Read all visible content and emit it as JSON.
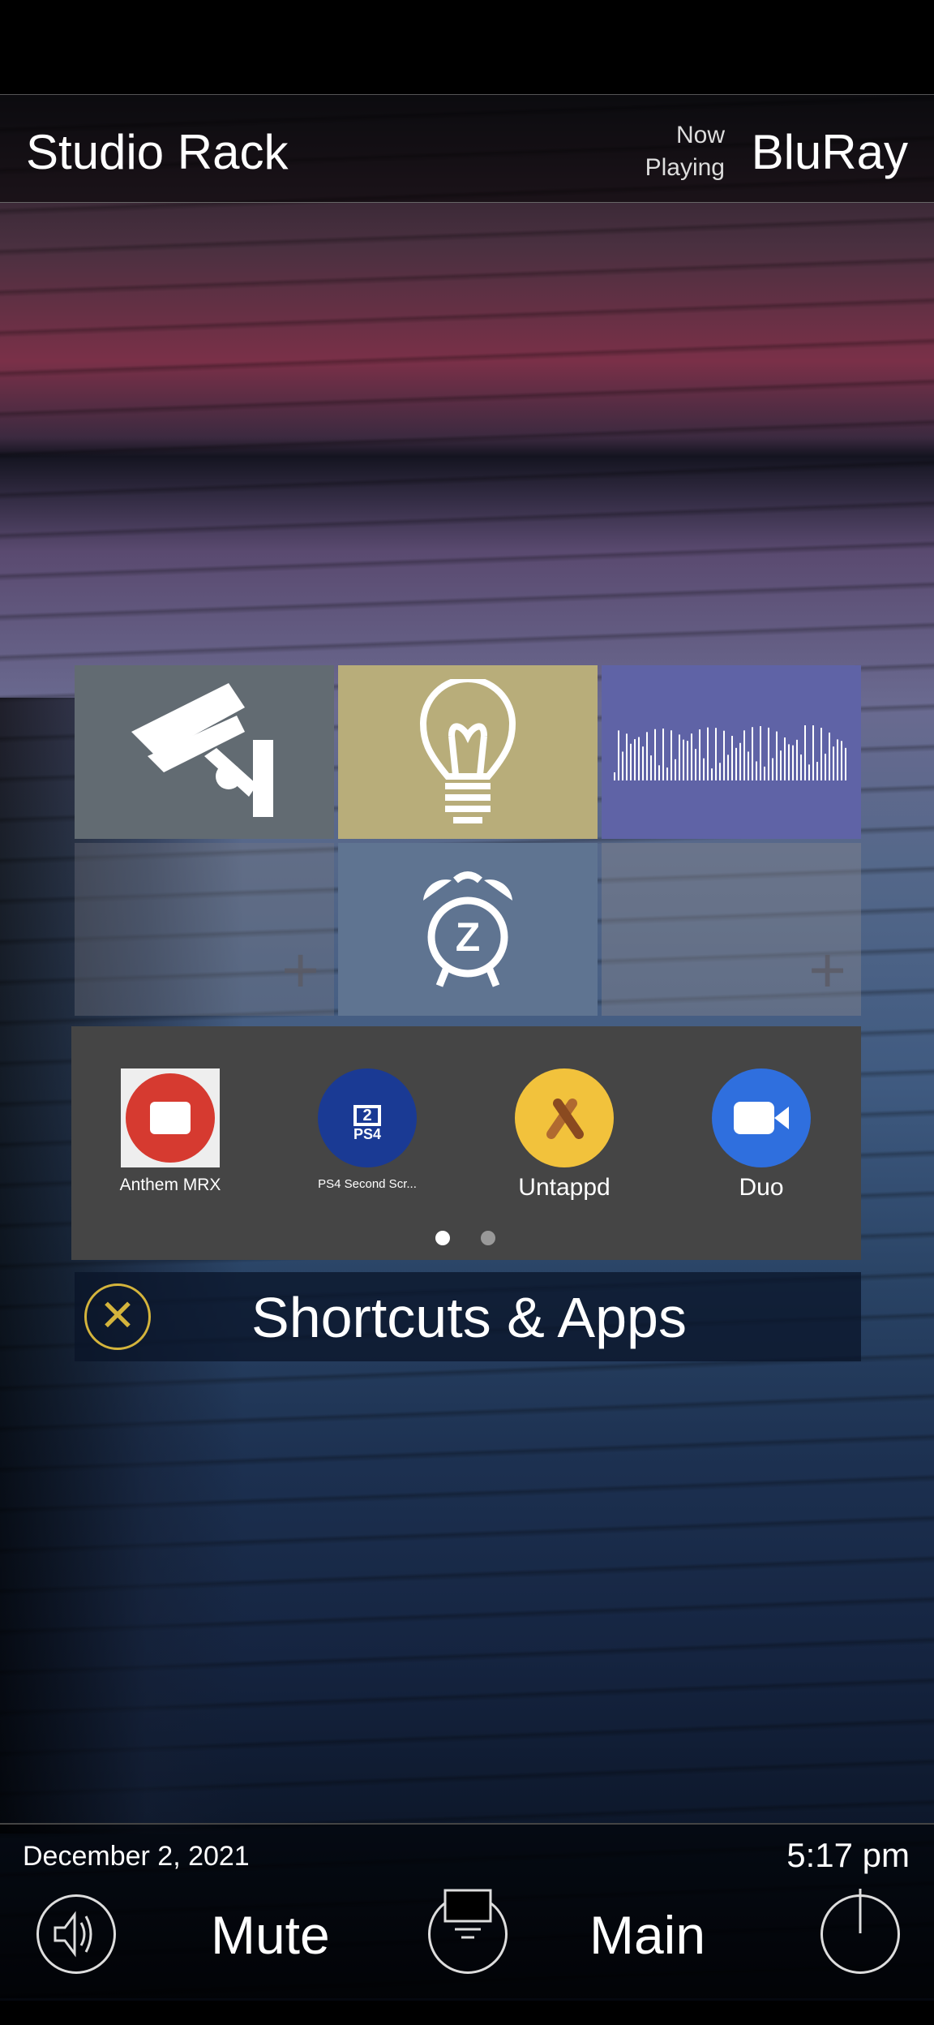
{
  "header": {
    "title": "Studio Rack",
    "now_playing_label_1": "Now",
    "now_playing_label_2": "Playing",
    "source": "BluRay"
  },
  "tiles": [
    {
      "icon": "security-camera-icon",
      "color": "#626b72"
    },
    {
      "icon": "light-bulb-icon",
      "color": "#b8ad7a"
    },
    {
      "icon": "audio-waveform-icon",
      "color": "#5f63a6"
    },
    {
      "icon": "add-icon",
      "label": "+"
    },
    {
      "icon": "alarm-clock-icon",
      "color": "#5f7491"
    },
    {
      "icon": "add-icon",
      "label": "+"
    }
  ],
  "apps": [
    {
      "label": "Anthem MRX",
      "icon": "anthem-icon",
      "color": "#d63a30"
    },
    {
      "label": "PS4 Second Scr...",
      "icon": "ps4-second-screen-icon",
      "color": "#1a3a94",
      "badge": "2",
      "sub": "PS4"
    },
    {
      "label": "Untappd",
      "icon": "untappd-icon",
      "color": "#f2c23c"
    },
    {
      "label": "Duo",
      "icon": "duo-icon",
      "color": "#2f6fde"
    }
  ],
  "pager": {
    "pages": 2,
    "current": 1
  },
  "shortcuts": {
    "title": "Shortcuts & Apps",
    "close": "✕"
  },
  "footer": {
    "date": "December 2, 2021",
    "time": "5:17 pm",
    "mute": "Mute",
    "main": "Main"
  }
}
